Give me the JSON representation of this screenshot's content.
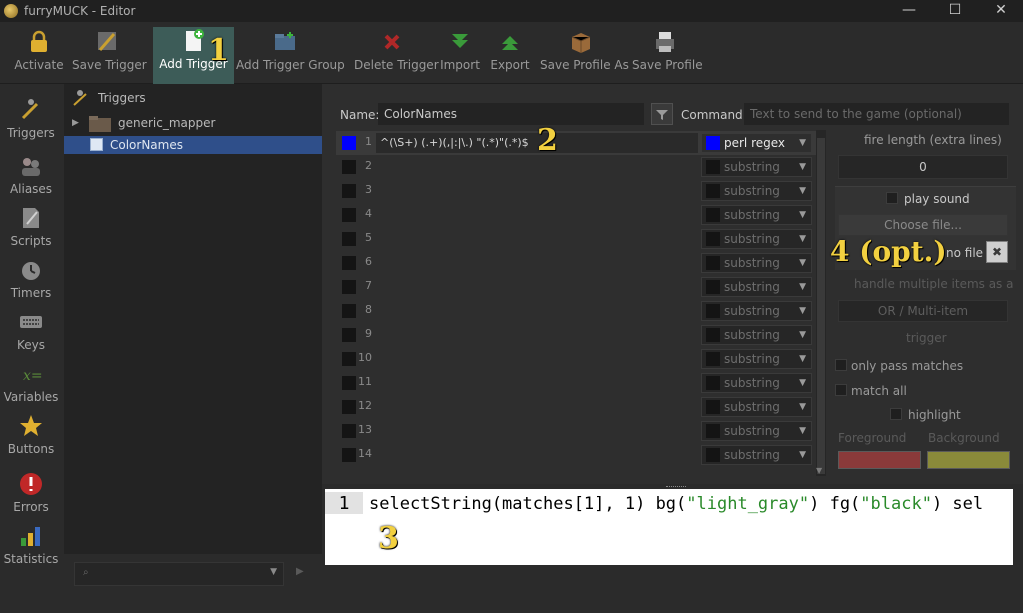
{
  "window": {
    "title": "furryMUCK - Editor",
    "minimize": "—",
    "maximize": "☐",
    "close": "✕"
  },
  "toolbar": {
    "activate": "Activate",
    "save_trigger": "Save Trigger",
    "add_trigger": "Add Trigger",
    "add_trigger_group": "Add Trigger Group",
    "delete_trigger": "Delete Trigger",
    "import": "Import",
    "export": "Export",
    "save_profile_as": "Save Profile As",
    "save_profile": "Save Profile"
  },
  "sidebar": [
    "Triggers",
    "Aliases",
    "Scripts",
    "Timers",
    "Keys",
    "Variables",
    "Buttons",
    "Errors",
    "Statistics"
  ],
  "tree": {
    "root": "Triggers",
    "group": "generic_mapper",
    "selected": "ColorNames"
  },
  "editor": {
    "name_label": "Name:",
    "name_value": "ColorNames",
    "command_label": "Command:",
    "command_placeholder": "Text to send to the game (optional)"
  },
  "patterns": [
    {
      "num": "1",
      "text": "^(\\S+) (.+)(,|:|\\.) \"(.*)\"(.*)$",
      "type": "perl regex",
      "active": true
    },
    {
      "num": "2",
      "text": "",
      "type": "substring",
      "active": false
    },
    {
      "num": "3",
      "text": "",
      "type": "substring",
      "active": false
    },
    {
      "num": "4",
      "text": "",
      "type": "substring",
      "active": false
    },
    {
      "num": "5",
      "text": "",
      "type": "substring",
      "active": false
    },
    {
      "num": "6",
      "text": "",
      "type": "substring",
      "active": false
    },
    {
      "num": "7",
      "text": "",
      "type": "substring",
      "active": false
    },
    {
      "num": "8",
      "text": "",
      "type": "substring",
      "active": false
    },
    {
      "num": "9",
      "text": "",
      "type": "substring",
      "active": false
    },
    {
      "num": "10",
      "text": "",
      "type": "substring",
      "active": false
    },
    {
      "num": "11",
      "text": "",
      "type": "substring",
      "active": false
    },
    {
      "num": "12",
      "text": "",
      "type": "substring",
      "active": false
    },
    {
      "num": "13",
      "text": "",
      "type": "substring",
      "active": false
    },
    {
      "num": "14",
      "text": "",
      "type": "substring",
      "active": false
    }
  ],
  "options": {
    "fire_length": "fire length (extra lines)",
    "fire_length_value": "0",
    "play_sound": "play sound",
    "choose_file": "Choose file...",
    "no_file": "no file",
    "multi_line_1": "handle multiple items as a",
    "multi_line_2": "OR / Multi-item",
    "multi_line_3": "trigger",
    "only_pass_matches": "only pass matches",
    "match_all": "match all",
    "highlight": "highlight",
    "foreground": "Foreground",
    "background": "Background"
  },
  "code": {
    "line_number": "1",
    "p1": "selectString(matches[1], 1) bg(",
    "s1": "\"light_gray\"",
    "p2": ") fg(",
    "s2": "\"black\"",
    "p3": ") sel"
  },
  "steps": {
    "s1": "1",
    "s2": "2",
    "s3": "3",
    "s4": "4 (opt.)"
  },
  "colors": {
    "accent": "#3d5c58",
    "selected_row": "#2f4f8a",
    "active_pattern": "#0000ff",
    "fg_swatch": "#8a3a3a",
    "bg_swatch": "#8a8a3a"
  }
}
